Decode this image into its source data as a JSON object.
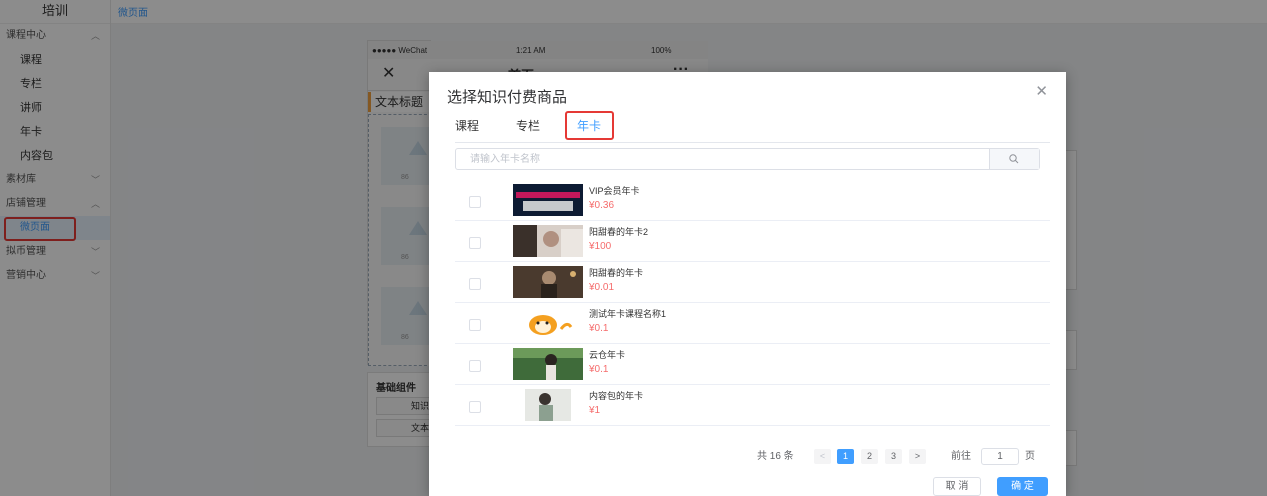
{
  "sidebar": {
    "brand": "培训",
    "groups": [
      {
        "label": "课程中心",
        "items": [
          "课程",
          "专栏",
          "讲师",
          "年卡",
          "内容包"
        ]
      },
      {
        "label": "素材库"
      },
      {
        "label": "店铺管理",
        "items": [
          "微页面"
        ]
      },
      {
        "label": "拟币管理"
      },
      {
        "label": "营销中心"
      }
    ]
  },
  "topbar": {
    "breadcrumb": "微页面"
  },
  "phone": {
    "carrier": "●●●●● WeChat",
    "time": "1:21 AM",
    "battery": "100%",
    "title": "首页",
    "module_title": "文本标题",
    "base_title": "基础组件",
    "base_btns": [
      "知识",
      "文本"
    ]
  },
  "dialog": {
    "title": "选择知识付费商品",
    "tabs": [
      "课程",
      "专栏",
      "年卡"
    ],
    "active_tab": "年卡",
    "search_placeholder": "请输入年卡名称",
    "items": [
      {
        "name": "VIP会员年卡",
        "price": "¥0.36"
      },
      {
        "name": "阳甜春的年卡2",
        "price": "¥100"
      },
      {
        "name": "阳甜春的年卡",
        "price": "¥0.01"
      },
      {
        "name": "测试年卡课程名称1",
        "price": "¥0.1"
      },
      {
        "name": "云仓年卡",
        "price": "¥0.1"
      },
      {
        "name": "内容包的年卡",
        "price": "¥1"
      }
    ],
    "pager": {
      "total": "共 16 条",
      "pages": [
        "1",
        "2",
        "3"
      ],
      "goto_prefix": "前往",
      "goto_value": "1",
      "goto_suffix": "页",
      "prev": "<",
      "next": ">"
    },
    "cancel": "取 消",
    "ok": "确 定"
  },
  "colors": {
    "accent": "#409eff",
    "price": "#f56c6c",
    "highlight": "#e53935"
  }
}
